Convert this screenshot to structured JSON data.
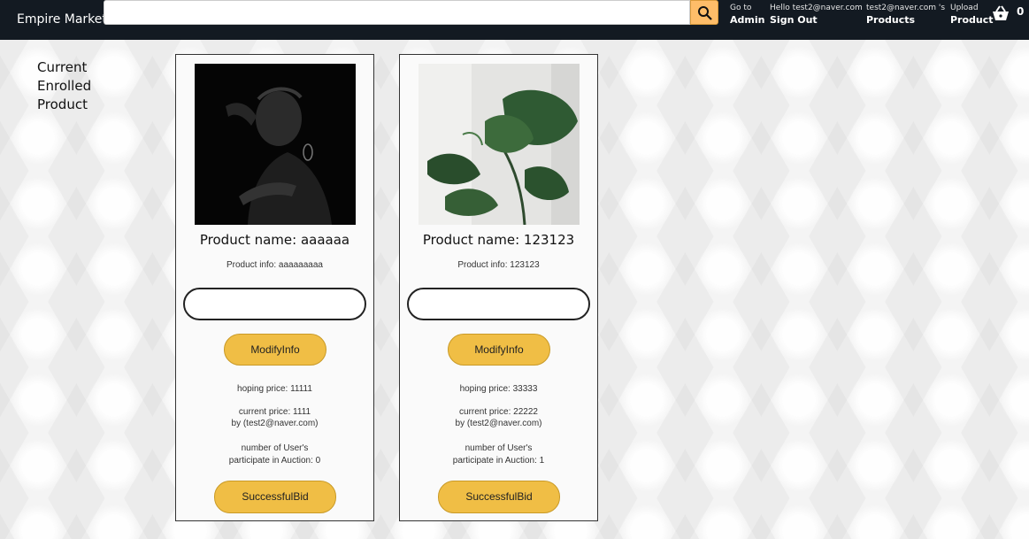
{
  "header": {
    "brand": "Empire Market",
    "search": {
      "value": "",
      "placeholder": ""
    },
    "admin": {
      "small": "Go to",
      "big": "Admin"
    },
    "signout": {
      "small": "Hello test2@naver.com",
      "big": "Sign Out"
    },
    "products": {
      "small": "test2@naver.com 's",
      "big": "Products"
    },
    "upload": {
      "small": "Upload",
      "big": "Product"
    },
    "cart_count": "0"
  },
  "side_title": [
    "Current",
    "Enrolled",
    "Product"
  ],
  "cards": [
    {
      "name": "Product name: aaaaaa",
      "info": "Product info: aaaaaaaaa",
      "input_value": "",
      "modify_label": "ModifyInfo",
      "hoping_price": "hoping price: 11111",
      "current_price": "current price: 1111",
      "bidder": "by (test2@naver.com)",
      "participants_line1": "number of User's",
      "participants_line2": "participate in Auction: 0",
      "success_label": "SuccessfulBid"
    },
    {
      "name": "Product name: 123123",
      "info": "Product info: 123123",
      "input_value": "",
      "modify_label": "ModifyInfo",
      "hoping_price": "hoping price: 33333",
      "current_price": "current price: 22222",
      "bidder": "by (test2@naver.com)",
      "participants_line1": "number of User's",
      "participants_line2": "participate in Auction: 1",
      "success_label": "SuccessfulBid"
    }
  ],
  "colors": {
    "header_bg": "#131a22",
    "accent": "#febd69",
    "button": "#f0be45"
  }
}
